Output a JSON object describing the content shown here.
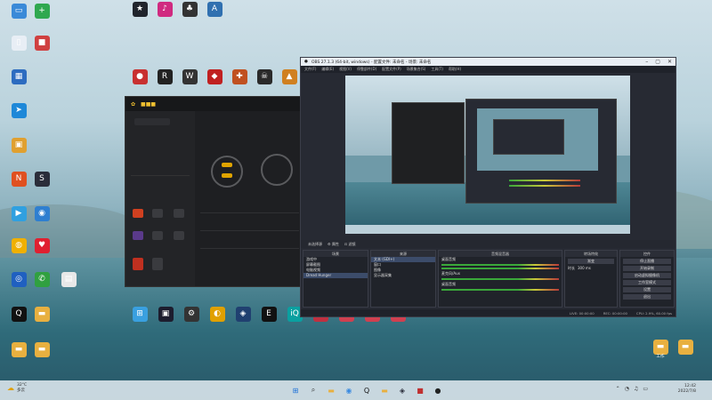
{
  "desktop_icons": [
    {
      "label": "",
      "color": "#3a8ad8",
      "glyph": "▭"
    },
    {
      "label": "",
      "color": "#2fa84f",
      "glyph": "+"
    },
    {
      "label": "",
      "color": "#e8eef5",
      "glyph": "▯"
    },
    {
      "label": "",
      "color": "#d04040",
      "glyph": "■"
    },
    {
      "label": "",
      "color": "#2d6cc0",
      "glyph": "▦"
    },
    {
      "label": "",
      "color": "#1e88d8",
      "glyph": "➤"
    },
    {
      "label": "",
      "color": "#e0a030",
      "glyph": "▣"
    },
    {
      "label": "",
      "color": "#2a2d3a",
      "glyph": "S"
    },
    {
      "label": "",
      "color": "#e05020",
      "glyph": "N"
    },
    {
      "label": "",
      "color": "#30a0e0",
      "glyph": "▶"
    },
    {
      "label": "",
      "color": "#2f7fd0",
      "glyph": "◉"
    },
    {
      "label": "",
      "color": "#f0b000",
      "glyph": "◍"
    },
    {
      "label": "",
      "color": "#e02030",
      "glyph": "♥"
    },
    {
      "label": "",
      "color": "#2060c0",
      "glyph": "◎"
    },
    {
      "label": "",
      "color": "#30a040",
      "glyph": "✆"
    },
    {
      "label": "",
      "color": "#e8e8e8",
      "glyph": "▤"
    },
    {
      "label": "",
      "color": "#111",
      "glyph": "Q"
    },
    {
      "label": "",
      "color": "#e8b040",
      "glyph": "▬"
    },
    {
      "label": "",
      "color": "#e8b040",
      "glyph": "▬"
    },
    {
      "label": "",
      "color": "#e8b040",
      "glyph": "▬"
    }
  ],
  "top_icons": [
    {
      "label": "",
      "color": "#20242c",
      "glyph": "★"
    },
    {
      "label": "",
      "color": "#d02a80",
      "glyph": "♪"
    },
    {
      "label": "",
      "color": "#333",
      "glyph": "♣"
    },
    {
      "label": "",
      "color": "#3070b0",
      "glyph": "A"
    }
  ],
  "game_icons": [
    {
      "label": "",
      "color": "#c83030",
      "glyph": "●"
    },
    {
      "label": "",
      "color": "#222",
      "glyph": "R"
    },
    {
      "label": "",
      "color": "#333",
      "glyph": "W"
    },
    {
      "label": "",
      "color": "#c02020",
      "glyph": "◆"
    },
    {
      "label": "",
      "color": "#c05020",
      "glyph": "✚"
    },
    {
      "label": "",
      "color": "#2a2a2a",
      "glyph": "☠"
    },
    {
      "label": "",
      "color": "#d08020",
      "glyph": "▲"
    }
  ],
  "bottom_icons": [
    {
      "label": "",
      "color": "#3aa0e0",
      "glyph": "⊞"
    },
    {
      "label": "",
      "color": "#1d1d2e",
      "glyph": "▣"
    },
    {
      "label": "",
      "color": "#333",
      "glyph": "⚙"
    },
    {
      "label": "",
      "color": "#e0a000",
      "glyph": "◐"
    },
    {
      "label": "",
      "color": "#204070",
      "glyph": "◈"
    },
    {
      "label": "",
      "color": "#111",
      "glyph": "E"
    },
    {
      "label": "",
      "color": "#0aa0a0",
      "glyph": "iQ"
    },
    {
      "label": "",
      "color": "#c03040",
      "glyph": "▣"
    },
    {
      "label": "",
      "color": "#d04050",
      "glyph": "▣"
    },
    {
      "label": "",
      "color": "#d04050",
      "glyph": "▣"
    },
    {
      "label": "",
      "color": "#d04050",
      "glyph": "▣"
    }
  ],
  "right_folders": [
    {
      "label": "工作"
    },
    {
      "label": ""
    }
  ],
  "app": {
    "colors": {
      "accent": "#e0a400"
    }
  },
  "obs": {
    "title": "OBS 27.1.3 (64-bit, windows) - 配置文件: 未命名 - 场景: 未命名",
    "menu": [
      "文件(F)",
      "编辑(E)",
      "视图(V)",
      "停靠部件(D)",
      "配置文件(P)",
      "场景集合(S)",
      "工具(T)",
      "帮助(H)"
    ],
    "scene_bar": [
      "未选择源",
      "⚙ 属性",
      "⊡ 滤镜"
    ],
    "scenes_header": "场景",
    "scenes": [
      "游戏中",
      "屏幕截图",
      "电脑视频",
      "Dread Hunger"
    ],
    "sources_header": "来源",
    "sources": [
      "文本 (GDI+)",
      "窗口",
      "图像",
      "显示器采集"
    ],
    "mixer_header": "音频混音器",
    "mixer": [
      "桌面音频",
      "麦克风/Aux",
      "桌面音频"
    ],
    "transitions_header": "转场特效",
    "transition_type": "渐变",
    "duration_label": "时长",
    "duration_value": "300 ms",
    "controls_header": "控件",
    "controls": [
      "停止直播",
      "开始录制",
      "启动虚拟摄像机",
      "工作室模式",
      "设置",
      "退出"
    ],
    "status": [
      "LIVE: 00:00:00",
      "REC: 00:00:00",
      "CPU: 2.9%, 60.00 fps"
    ]
  },
  "taskbar": {
    "weather_temp": "32°C",
    "weather_desc": "多云",
    "time": "12:42",
    "date": "2022/7/8",
    "apps": [
      {
        "name": "start-icon",
        "glyph": "⊞",
        "color": "#1a6fd8"
      },
      {
        "name": "search-icon",
        "glyph": "⌕",
        "color": "#333"
      },
      {
        "name": "explorer-icon",
        "glyph": "▬",
        "color": "#e8b040"
      },
      {
        "name": "chrome-icon",
        "glyph": "◉",
        "color": "#3a8ae0"
      },
      {
        "name": "qq-icon",
        "glyph": "Q",
        "color": "#111"
      },
      {
        "name": "folder-icon",
        "glyph": "▬",
        "color": "#e8b040"
      },
      {
        "name": "app-icon",
        "glyph": "◈",
        "color": "#2a2d3a"
      },
      {
        "name": "game-icon",
        "glyph": "■",
        "color": "#c03030"
      },
      {
        "name": "obs-icon",
        "glyph": "●",
        "color": "#222"
      }
    ]
  }
}
